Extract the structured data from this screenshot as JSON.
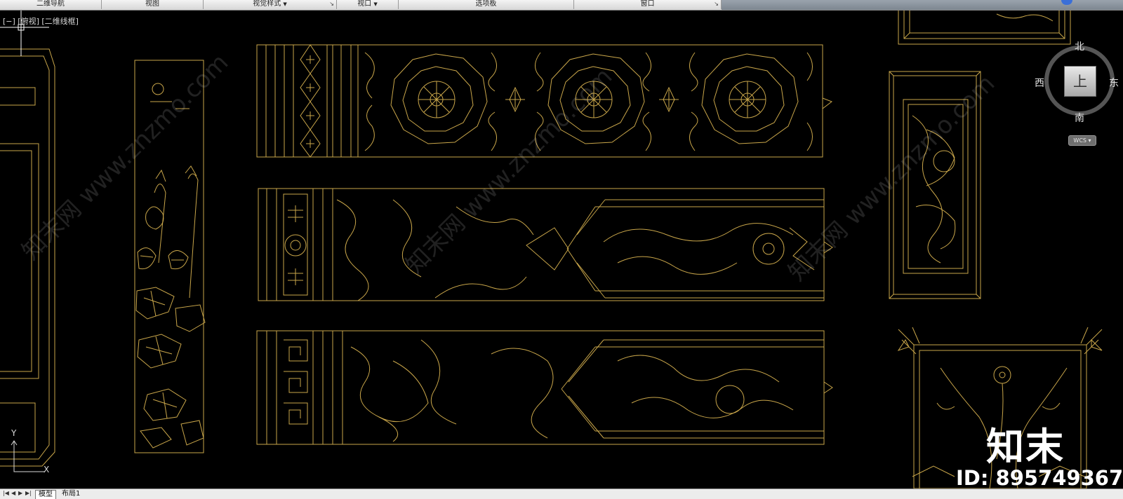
{
  "ribbon": {
    "panels": [
      {
        "label": "二维导航"
      },
      {
        "label": "视图"
      },
      {
        "label": "视觉样式",
        "dropdown": true
      },
      {
        "label": "视口",
        "dropdown": true
      },
      {
        "label": "选项板"
      },
      {
        "label": "窗口"
      }
    ]
  },
  "viewport": {
    "label": "[−] [俯视] [二维线框]"
  },
  "viewcube": {
    "north": "北",
    "south": "南",
    "east": "东",
    "west": "西",
    "face": "上",
    "wcs": "WCS"
  },
  "ucs": {
    "x": "X",
    "y": "Y"
  },
  "watermark": {
    "text": "知末网 www.znzmo.com",
    "brand": "知末",
    "id": "ID: 895749367"
  },
  "tabs": {
    "model": "模型",
    "layout1": "布局1"
  },
  "colors": {
    "drawing_line": "#c9a64a",
    "background": "#000000",
    "ribbon": "#e4e4e4"
  },
  "icons": {
    "nav": [
      "first-icon",
      "prev-icon",
      "next-icon",
      "last-icon"
    ]
  }
}
